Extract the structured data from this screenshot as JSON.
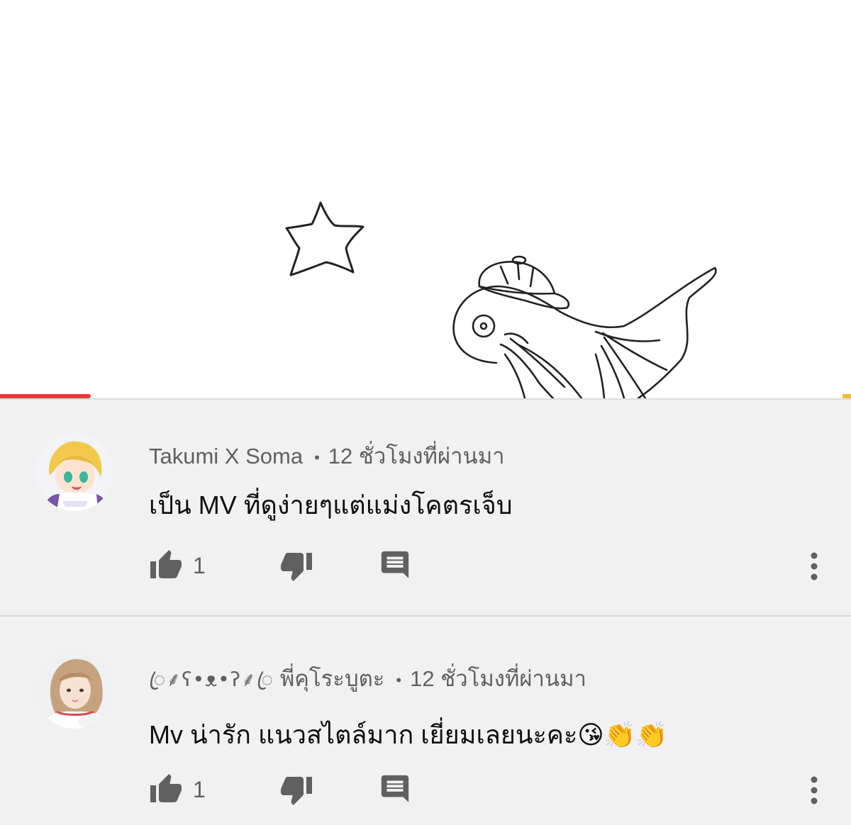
{
  "player": {
    "played_fraction": 0.107,
    "accent_color": "#e53935",
    "buffer_color": "#f6b93b"
  },
  "comments": [
    {
      "author": "Takumi X Soma",
      "separator": "•",
      "time": "12 ชั่วโมงที่ผ่านมา",
      "text": "เป็น MV ที่ดูง่ายๆแต่แม่งโคตรเจ็บ",
      "likes": "1",
      "avatar": "anime-boy-avatar"
    },
    {
      "author_prefix": "ꦿ⸙ʕ•ᴥ•ʔ⸙ꦿ",
      "author": "พี่คุโระบูตะ",
      "separator": "•",
      "time": "12 ชั่วโมงที่ผ่านมา",
      "text": "Mv น่ารัก แนวสไตล์มาก เยี่ยมเลยนะคะ😘👏👏",
      "likes": "1",
      "avatar": "girl-photo-avatar"
    }
  ],
  "icons": {
    "like": "thumb-up-icon",
    "dislike": "thumb-down-icon",
    "reply": "comment-icon",
    "more": "more-vert-icon"
  }
}
